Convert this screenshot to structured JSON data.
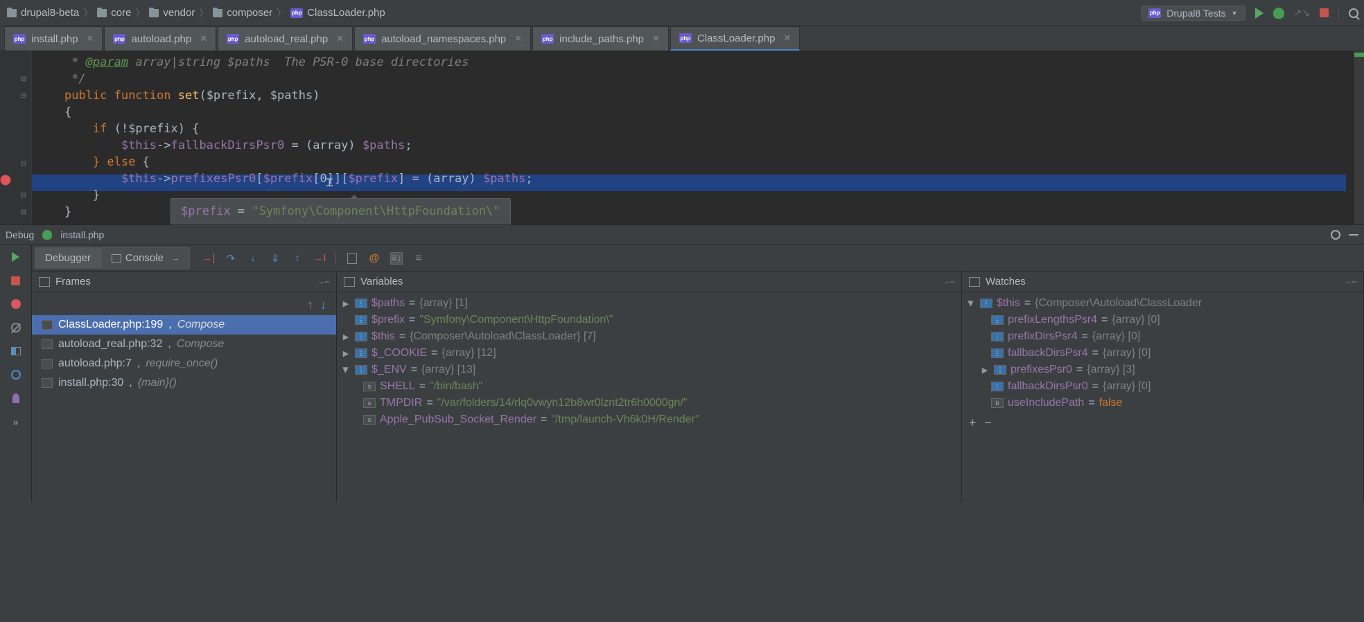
{
  "breadcrumb": [
    {
      "icon": "folder",
      "label": "drupal8-beta"
    },
    {
      "icon": "folder",
      "label": "core"
    },
    {
      "icon": "folder",
      "label": "vendor"
    },
    {
      "icon": "folder",
      "label": "composer"
    },
    {
      "icon": "php",
      "label": "ClassLoader.php"
    }
  ],
  "runConfig": "Drupal8 Tests",
  "tabs": [
    {
      "label": "install.php",
      "active": false,
      "underlined": false
    },
    {
      "label": "autoload.php",
      "active": false,
      "underlined": false
    },
    {
      "label": "autoload_real.php",
      "active": false,
      "underlined": false
    },
    {
      "label": "autoload_namespaces.php",
      "active": false,
      "underlined": false
    },
    {
      "label": "include_paths.php",
      "active": false,
      "underlined": false
    },
    {
      "label": "ClassLoader.php",
      "active": true,
      "underlined": true
    }
  ],
  "code": {
    "docParamTag": "@param",
    "docParamType": "array|string $paths  The PSR-0 base directories",
    "fnKw": "public function",
    "fnName": "set",
    "fnParams": "($prefix, $paths)",
    "openBrace": "{",
    "ifKw": "if",
    "ifCond": " (!$prefix) {",
    "thisVar": "$this",
    "fallbackProp": "fallbackDirsPsr0",
    "castArray": "(array)",
    "pathsVar": "$paths",
    "elseKw": "} else {",
    "prefixesPsr0": "prefixesPsr0",
    "prefixVar": "$prefix",
    "bracket0": "[0]",
    "closeBrace1": "}",
    "closeBrace2": "}"
  },
  "tooltip": {
    "var": "$prefix",
    "eq": " = ",
    "val": "\"Symfony\\Component\\HttpFoundation\\\""
  },
  "debugHeader": {
    "title": "Debug",
    "file": "install.php"
  },
  "debuggerTabs": {
    "debugger": "Debugger",
    "console": "Console"
  },
  "framesPanel": {
    "title": "Frames",
    "items": [
      {
        "file": "ClassLoader.php:199",
        "ctx": "Compose",
        "selected": true
      },
      {
        "file": "autoload_real.php:32",
        "ctx": "Compose",
        "selected": false
      },
      {
        "file": "autoload.php:7",
        "ctx": "require_once()",
        "selected": false
      },
      {
        "file": "install.php:30",
        "ctx": "{main}()",
        "selected": false
      }
    ]
  },
  "varsPanel": {
    "title": "Variables",
    "items": [
      {
        "expand": "closed",
        "icon": "arr",
        "name": "$paths",
        "val": "{array} [1]",
        "type": "type"
      },
      {
        "expand": "none",
        "icon": "arr",
        "name": "$prefix",
        "val": "\"Symfony\\Component\\HttpFoundation\\\"",
        "type": "str"
      },
      {
        "expand": "closed",
        "icon": "arr",
        "name": "$this",
        "val": "{Composer\\Autoload\\ClassLoader} [7]",
        "type": "type"
      },
      {
        "expand": "closed",
        "icon": "arr",
        "name": "$_COOKIE",
        "val": "{array} [12]",
        "type": "type"
      },
      {
        "expand": "open",
        "icon": "arr",
        "name": "$_ENV",
        "val": "{array} [13]",
        "type": "type"
      }
    ],
    "envChildren": [
      {
        "name": "SHELL",
        "val": "\"/bin/bash\""
      },
      {
        "name": "TMPDIR",
        "val": "\"/var/folders/14/rlq0vwyn12b8wr0lznt2tr6h0000gn/\""
      },
      {
        "name": "Apple_PubSub_Socket_Render",
        "val": "\"/tmp/launch-Vh6k0H/Render\""
      }
    ]
  },
  "watchesPanel": {
    "title": "Watches",
    "root": {
      "name": "$this",
      "val": "{Composer\\Autoload\\ClassLoader"
    },
    "children": [
      {
        "name": "prefixLengthsPsr4",
        "val": "{array} [0]",
        "expand": "none"
      },
      {
        "name": "prefixDirsPsr4",
        "val": "{array} [0]",
        "expand": "none"
      },
      {
        "name": "fallbackDirsPsr4",
        "val": "{array} [0]",
        "expand": "none"
      },
      {
        "name": "prefixesPsr0",
        "val": "{array} [3]",
        "expand": "closed"
      },
      {
        "name": "fallbackDirsPsr0",
        "val": "{array} [0]",
        "expand": "none"
      },
      {
        "name": "useIncludePath",
        "val": "false",
        "expand": "none",
        "kw": true
      }
    ]
  }
}
